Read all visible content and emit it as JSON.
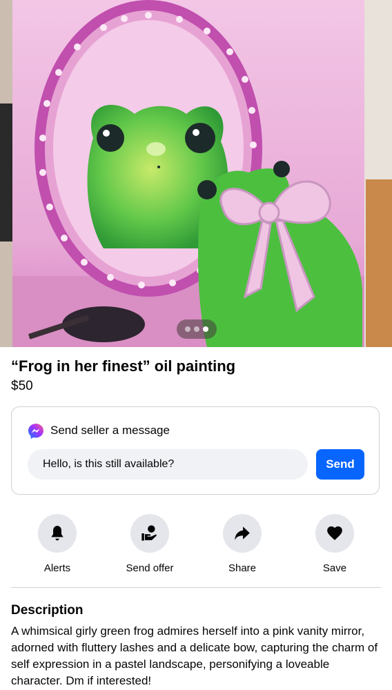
{
  "listing": {
    "title": "“Frog in her finest” oil painting",
    "price": "$50",
    "image_alt": "frog-oil-painting",
    "carousel": {
      "count": 3,
      "active": 3
    }
  },
  "message": {
    "header": "Send seller a message",
    "input_value": "Hello, is this still available?",
    "send_label": "Send",
    "icon": "messenger-icon"
  },
  "actions": [
    {
      "label": "Alerts",
      "icon": "bell-icon"
    },
    {
      "label": "Send offer",
      "icon": "offer-icon"
    },
    {
      "label": "Share",
      "icon": "share-icon"
    },
    {
      "label": "Save",
      "icon": "heart-icon"
    }
  ],
  "description": {
    "heading": "Description",
    "text": "A whimsical girly green frog admires herself into a pink vanity mirror, adorned with fluttery lashes and a delicate bow, capturing the charm of self expression in a pastel landscape, personifying a loveable character. Dm if interested!"
  },
  "colors": {
    "accent": "#0866ff",
    "button_bg": "#e4e6eb",
    "input_bg": "#f0f2f5",
    "painting_pink": "#e9b3d8",
    "frog_green": "#4fc24a"
  }
}
